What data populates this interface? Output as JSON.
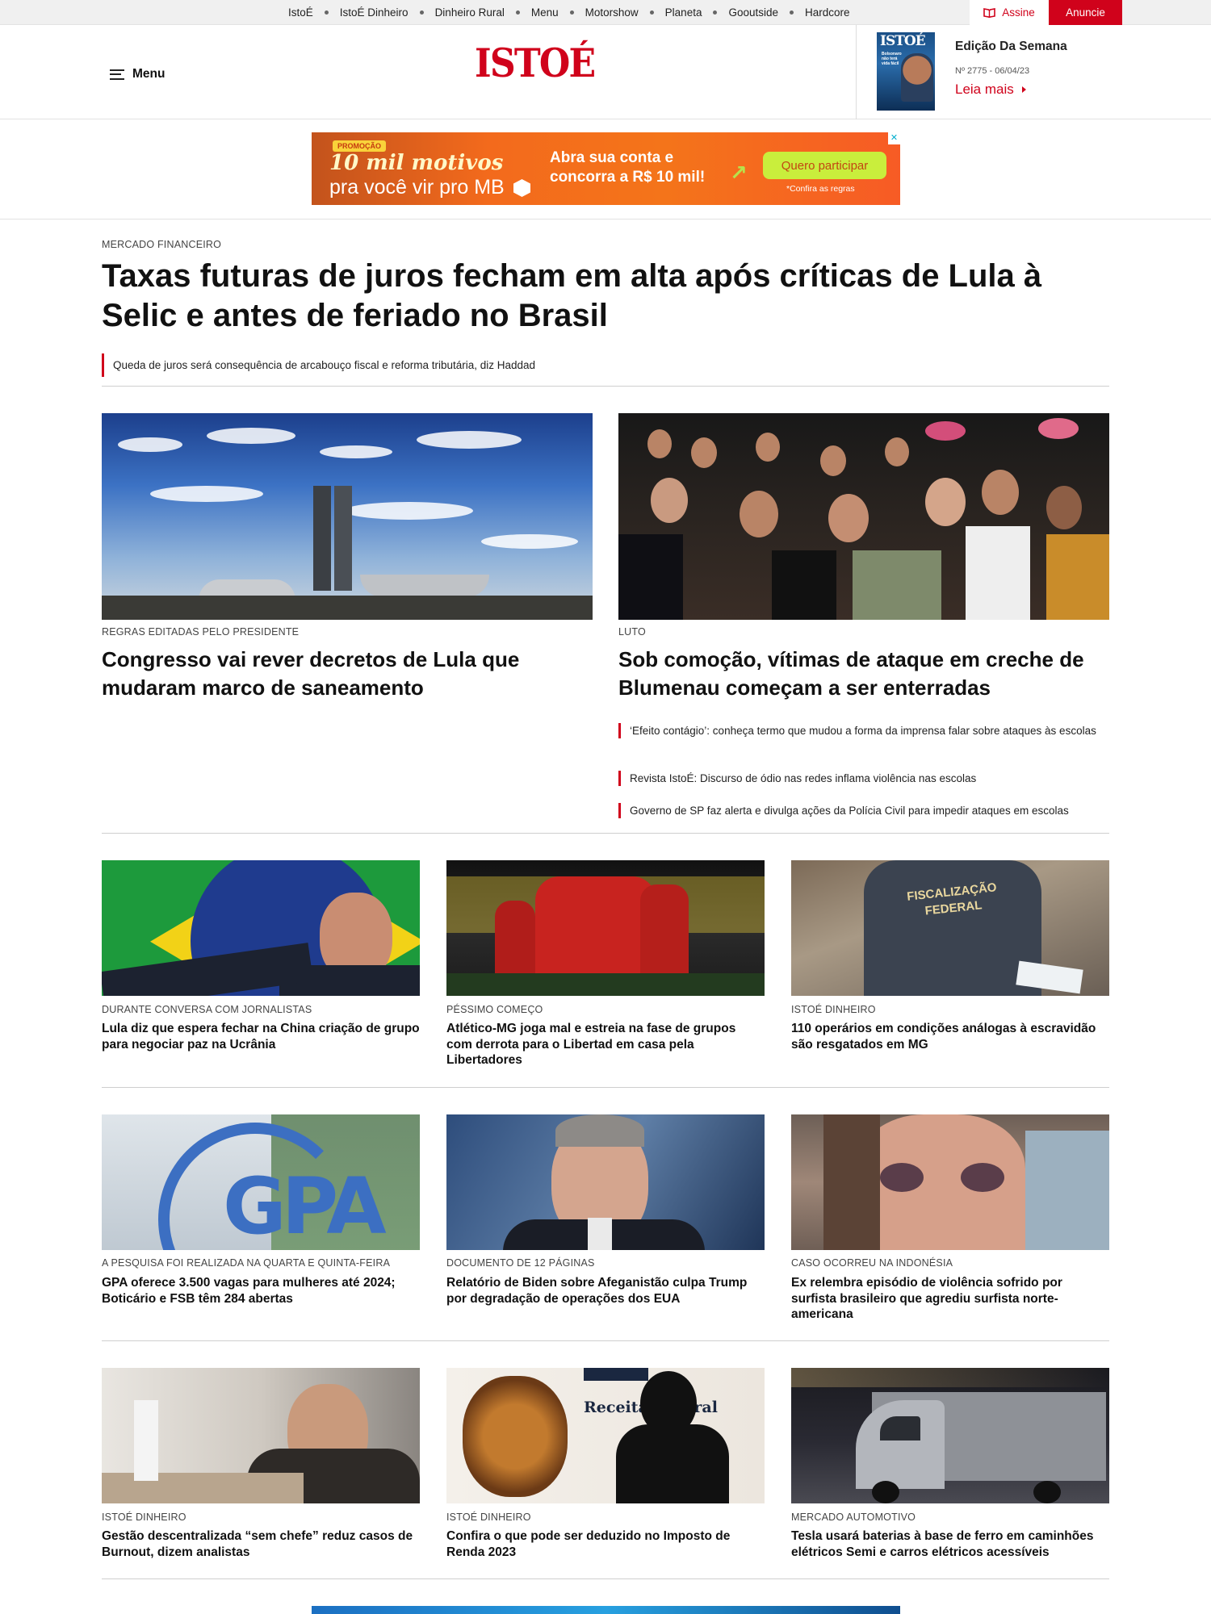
{
  "topnav": {
    "items": [
      "IstoÉ",
      "IstoÉ Dinheiro",
      "Dinheiro Rural",
      "Menu",
      "Motorshow",
      "Planeta",
      "Gooutside",
      "Hardcore"
    ],
    "assine": "Assine",
    "anuncie": "Anuncie"
  },
  "header": {
    "menu_label": "Menu",
    "logo": "ISTOÉ",
    "edition": {
      "cover_logo": "ISTOÉ",
      "cover_text": "Bolsonaro não terá vida fácil",
      "title": "Edição Da Semana",
      "number": "Nº 2775 - 06/04/23",
      "more": "Leia mais"
    }
  },
  "ad": {
    "promo": "PROMOÇÃO",
    "line1": "10 mil motivos",
    "line2": "pra você vir pro MB",
    "middle1": "Abra sua conta e",
    "middle2": "concorra a R$ 10 mil!",
    "cta": "Quero participar",
    "rules": "*Confira as regras",
    "close": "✕"
  },
  "main": {
    "kicker": "MERCADO FINANCEIRO",
    "headline": "Taxas futuras de juros fecham em alta após críticas de Lula à Selic e antes de feriado no Brasil",
    "related": "Queda de juros será consequência de arcabouço fiscal e reforma tributária, diz Haddad"
  },
  "featured": [
    {
      "kicker": "REGRAS EDITADAS PELO PRESIDENTE",
      "title": "Congresso vai rever decretos de Lula que mudaram marco de saneamento"
    },
    {
      "kicker": "LUTO",
      "title": "Sob comoção, vítimas de ataque em creche de Blumenau começam a ser enterradas",
      "related": [
        "‘Efeito contágio’: conheça termo que mudou a forma da imprensa falar sobre ataques às escolas",
        "Revista IstoÉ: Discurso de ódio nas redes inflama violência nas escolas",
        "Governo de SP faz alerta e divulga ações da Polícia Civil para impedir ataques em escolas"
      ]
    }
  ],
  "grid": [
    {
      "kicker": "DURANTE CONVERSA COM JORNALISTAS",
      "title": "Lula diz que espera fechar na China criação de grupo para negociar paz na Ucrânia"
    },
    {
      "kicker": "PÉSSIMO COMEÇO",
      "title": "Atlético-MG joga mal e estreia na fase de grupos com derrota para o Libertad em casa pela Libertadores"
    },
    {
      "kicker": "ISTOÉ DINHEIRO",
      "title": "110 operários em condições análogas à escravidão são resgatados em MG",
      "image_text": "FISCALIZAÇÃO FEDERAL"
    },
    {
      "kicker": "A PESQUISA FOI REALIZADA NA QUARTA E QUINTA-FEIRA",
      "title": "GPA oferece 3.500 vagas para mulheres até 2024; Boticário e FSB têm 284 abertas",
      "image_text": "GPA"
    },
    {
      "kicker": "DOCUMENTO DE 12 PÁGINAS",
      "title": "Relatório de Biden sobre Afeganistão culpa Trump por degradação de operações dos EUA"
    },
    {
      "kicker": "CASO OCORREU NA INDONÉSIA",
      "title": "Ex relembra episódio de violência sofrido por surfista brasileiro que agrediu surfista norte-americana"
    },
    {
      "kicker": "ISTOÉ DINHEIRO",
      "title": "Gestão descentralizada “sem chefe” reduz casos de Burnout, dizem analistas"
    },
    {
      "kicker": "ISTOÉ DINHEIRO",
      "title": "Confira o que pode ser deduzido no Imposto de Renda 2023",
      "image_text": "Receita Federal"
    },
    {
      "kicker": "MERCADO AUTOMOTIVO",
      "title": "Tesla usará baterias à base de ferro em caminhões elétricos Semi e carros elétricos acessíveis"
    }
  ],
  "colors": {
    "brand": "#d0021b",
    "text": "#111111",
    "divider": "#cfcfcf"
  }
}
